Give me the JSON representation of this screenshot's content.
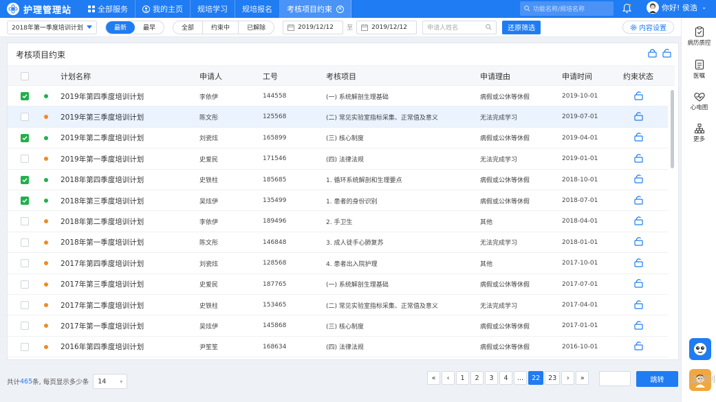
{
  "app": {
    "title": "护理管理站"
  },
  "nav": {
    "tabs": [
      {
        "label": "全部服务",
        "icon": "grid-icon"
      },
      {
        "label": "我的主页",
        "icon": "user-circle-icon"
      },
      {
        "label": "规培学习"
      },
      {
        "label": "规培报名"
      },
      {
        "label": "考核项目约束",
        "active": true
      }
    ],
    "search_placeholder": "功能名称/规培名称",
    "greeting": "你好! 侯浩"
  },
  "filters": {
    "plan_select": "2018年第一季度培训计划",
    "order_options": [
      "最新",
      "最早"
    ],
    "order_selected": "最新",
    "status_options": [
      "全部",
      "约束中",
      "已解除"
    ],
    "status_selected": "全部",
    "date_from": "2019/12/12",
    "date_to_label": "至",
    "date_to": "2019/12/12",
    "name_placeholder": "申请人姓名",
    "reset_label": "还原筛选",
    "content_settings": "内容设置"
  },
  "card": {
    "title": "考核项目约束"
  },
  "table": {
    "headers": [
      "计划名称",
      "申请人",
      "工号",
      "考核项目",
      "申请理由",
      "申请时间",
      "约束状态"
    ],
    "rows": [
      {
        "checked": true,
        "status": "green",
        "plan": "2019年第四季度培训计划",
        "applicant": "李依伊",
        "id": "144558",
        "item": "(一) 系统解剖生理基础",
        "reason": "病假或公休等休假",
        "date": "2019-10-01"
      },
      {
        "checked": false,
        "status": "orange",
        "plan": "2019年第三季度培训计划",
        "applicant": "陈文彤",
        "id": "125568",
        "item": "(二) 常见实验室指标采集、正常值及意义",
        "reason": "无法完成学习",
        "date": "2019-07-01",
        "highlight": true
      },
      {
        "checked": true,
        "status": "green",
        "plan": "2019年第二季度培训计划",
        "applicant": "刘瓷炫",
        "id": "165899",
        "item": "(三) 核心制度",
        "reason": "病假或公休等休假",
        "date": "2019-04-01"
      },
      {
        "checked": false,
        "status": "orange",
        "plan": "2019年第一季度培训计划",
        "applicant": "史爱民",
        "id": "171546",
        "item": "(四) 法律法规",
        "reason": "无法完成学习",
        "date": "2019-01-01"
      },
      {
        "checked": true,
        "status": "green",
        "plan": "2018年第四季度培训计划",
        "applicant": "史铁柱",
        "id": "185685",
        "item": "1. 循环系统解剖和生理要点",
        "reason": "病假或公休等休假",
        "date": "2018-10-01"
      },
      {
        "checked": true,
        "status": "green",
        "plan": "2018年第三季度培训计划",
        "applicant": "吴炫伊",
        "id": "135499",
        "item": "1. 患者的身份识别",
        "reason": "病假或公休等休假",
        "date": "2018-07-01"
      },
      {
        "checked": false,
        "status": "orange",
        "plan": "2018年第二季度培训计划",
        "applicant": "李依伊",
        "id": "189496",
        "item": "2. 手卫生",
        "reason": "其他",
        "date": "2018-04-01"
      },
      {
        "checked": false,
        "status": "orange",
        "plan": "2018年第一季度培训计划",
        "applicant": "陈文彤",
        "id": "146848",
        "item": "3. 成人徒手心肺复苏",
        "reason": "无法完成学习",
        "date": "2018-01-01"
      },
      {
        "checked": false,
        "status": "orange",
        "plan": "2017年第四季度培训计划",
        "applicant": "刘瓷炫",
        "id": "128568",
        "item": "4. 患者出入院护理",
        "reason": "其他",
        "date": "2017-10-01"
      },
      {
        "checked": false,
        "status": "orange",
        "plan": "2017年第三季度培训计划",
        "applicant": "史爱民",
        "id": "187765",
        "item": "(一) 系统解剖生理基础",
        "reason": "病假或公休等休假",
        "date": "2017-07-01"
      },
      {
        "checked": false,
        "status": "orange",
        "plan": "2017年第二季度培训计划",
        "applicant": "史铁柱",
        "id": "153465",
        "item": "(二) 常见实验室指标采集、正常值及意义",
        "reason": "无法完成学习",
        "date": "2017-04-01"
      },
      {
        "checked": false,
        "status": "orange",
        "plan": "2017年第一季度培训计划",
        "applicant": "吴炫伊",
        "id": "145868",
        "item": "(三) 核心制度",
        "reason": "病假或公休等休假",
        "date": "2017-01-01"
      },
      {
        "checked": false,
        "status": "orange",
        "plan": "2016年第四季度培训计划",
        "applicant": "尹笙笙",
        "id": "168634",
        "item": "(四) 法律法规",
        "reason": "病假或公休等休假",
        "date": "2016-10-01"
      }
    ]
  },
  "pagination": {
    "total_prefix": "共计",
    "total": "465",
    "total_suffix": "条, 每页显示多少条",
    "page_size": "14",
    "pages": [
      "«",
      "‹",
      "1",
      "2",
      "3",
      "4",
      "...",
      "22",
      "23",
      "›",
      "»"
    ],
    "current": "22",
    "jump_label": "跳转"
  },
  "right_sidebar": {
    "items": [
      {
        "label": "病历质控",
        "icon": "clipboard-icon"
      },
      {
        "label": "医嘱",
        "icon": "document-icon"
      },
      {
        "label": "心电图",
        "icon": "heart-pulse-icon"
      },
      {
        "label": "更多",
        "icon": "org-chart-icon"
      }
    ],
    "bot_text": "主转到"
  },
  "colors": {
    "primary": "#1f7cf2",
    "green": "#21b04b",
    "orange": "#f08a24",
    "highlight": "#eaf3fe"
  }
}
